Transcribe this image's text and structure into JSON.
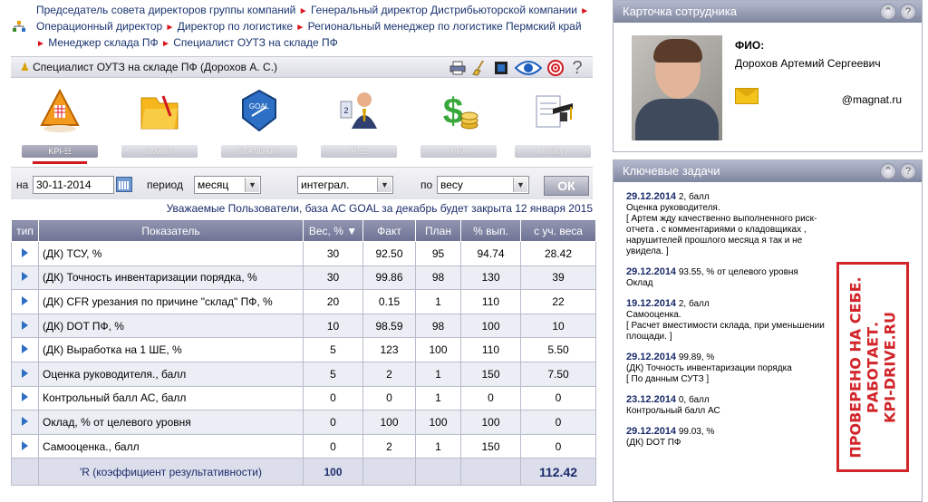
{
  "breadcrumb": {
    "items": [
      "Председатель совета директоров группы компаний",
      "Генеральный директор Дистрибьюторской компании",
      "Операционный директор",
      "Директор по логистике",
      "Региональный менеджер по логистике Пермский край",
      "Менеджер склада ПФ",
      "Специалист ОУТЗ на складе ПФ"
    ]
  },
  "user_bar": {
    "title": "Специалист ОУТЗ на складе ПФ  (Дорохов А. С.)",
    "help": "?"
  },
  "modules": [
    {
      "label": "KPI-☷",
      "icon": "kpi-warning-icon",
      "active": true
    },
    {
      "label": "SMART",
      "icon": "smart-folder-icon",
      "active": false
    },
    {
      "label": "STANDART",
      "icon": "goal-badge-icon",
      "active": false
    },
    {
      "label": "R-☷",
      "icon": "rating-user-icon",
      "active": false
    },
    {
      "label": "PFX",
      "icon": "dollar-coins-icon",
      "active": false
    },
    {
      "label": "Policy",
      "icon": "policy-scroll-icon",
      "active": false
    }
  ],
  "filters": {
    "date_label": "на",
    "date": "30-11-2014",
    "period_label": "период",
    "period": "месяц",
    "mode": "интеграл.",
    "by_label": "по",
    "by": "весу",
    "ok": "ОК"
  },
  "notice": "Уважаемые Пользователи, база АС GOAL за декабрь будет закрыта 12 января 2015",
  "table": {
    "headers": [
      "тип",
      "Показатель",
      "Вес, % ▼",
      "Факт",
      "План",
      "% вып.",
      "с уч. веса"
    ],
    "rows": [
      [
        "(ДК) ТСУ, %",
        "30",
        "92.50",
        "95",
        "94.74",
        "28.42"
      ],
      [
        "(ДК) Точность инвентаризации порядка, %",
        "30",
        "99.86",
        "98",
        "130",
        "39"
      ],
      [
        "(ДК) CFR урезания по причине \"склад\" ПФ, %",
        "20",
        "0.15",
        "1",
        "110",
        "22"
      ],
      [
        "(ДК) DOT ПФ, %",
        "10",
        "98.59",
        "98",
        "100",
        "10"
      ],
      [
        "(ДК) Выработка на 1 ШЕ, %",
        "5",
        "123",
        "100",
        "110",
        "5.50"
      ],
      [
        "Оценка руководителя., балл",
        "5",
        "2",
        "1",
        "150",
        "7.50"
      ],
      [
        "Контрольный балл АС, балл",
        "0",
        "0",
        "1",
        "0",
        "0"
      ],
      [
        "Оклад, % от целевого уровня",
        "0",
        "100",
        "100",
        "100",
        "0"
      ],
      [
        "Самооценка., балл",
        "0",
        "2",
        "1",
        "150",
        "0"
      ]
    ],
    "footer": {
      "label": "'R (коэффициент результативности)",
      "weight": "100",
      "total": "112.42"
    }
  },
  "employee_card": {
    "title": "Карточка сотрудника",
    "fio_label": "ФИО:",
    "fio": "Дорохов Артемий Сергеевич",
    "email": "@magnat.ru"
  },
  "key_tasks": {
    "title": "Ключевые задачи",
    "items": [
      {
        "date": "29.12.2014",
        "meta": " 2, балл",
        "text": "Оценка руководителя.",
        "note": "[ Артем жду качественно выполненного риск- отчета . с комментариями о кладовщиках , нарушителей прошлого месяца я так и не увидела. ]"
      },
      {
        "date": "29.12.2014",
        "meta": " 93.55, % от целевого уровня",
        "text": "Оклад",
        "note": ""
      },
      {
        "date": "19.12.2014",
        "meta": " 2, балл",
        "text": "Самооценка.",
        "note": "[ Расчет вместимости склада, при уменьшении площади. ]"
      },
      {
        "date": "29.12.2014",
        "meta": " 99.89, %",
        "text": "(ДК) Точность инвентаризации порядка",
        "note": "[ По данным СУТЗ ]"
      },
      {
        "date": "23.12.2014",
        "meta": " 0, балл",
        "text": "Контрольный балл АС",
        "note": ""
      },
      {
        "date": "29.12.2014",
        "meta": " 99.03, %",
        "text": "(ДК) DOT ПФ",
        "note": ""
      }
    ]
  },
  "watermark": [
    "ПРОВЕРЕНО НА СЕБЕ.",
    "РАБОТАЕТ.",
    "KPI-DRIVE.RU"
  ]
}
